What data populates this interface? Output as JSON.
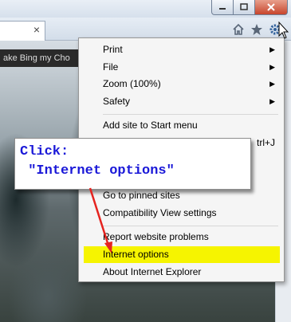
{
  "page": {
    "strip_text": "ake Bing my Cho"
  },
  "tab": {
    "close": "×"
  },
  "menu": {
    "items": [
      {
        "label": "Print",
        "submenu": true,
        "highlight": false
      },
      {
        "label": "File",
        "submenu": true,
        "highlight": false
      },
      {
        "label": "Zoom (100%)",
        "submenu": true,
        "highlight": false
      },
      {
        "label": "Safety",
        "submenu": true,
        "highlight": false
      },
      {
        "label": "Add site to Start menu",
        "submenu": false,
        "highlight": false
      },
      {
        "label": "Go to pinned sites",
        "submenu": false,
        "highlight": false
      },
      {
        "label": "Compatibility View settings",
        "submenu": false,
        "highlight": false
      },
      {
        "label": "Report website problems",
        "submenu": false,
        "highlight": false
      },
      {
        "label": "Internet options",
        "submenu": false,
        "highlight": true
      },
      {
        "label": "About Internet Explorer",
        "submenu": false,
        "highlight": false
      }
    ],
    "partial_shortcut": "trl+J"
  },
  "callout": {
    "line1": "Click:",
    "line2": " \"Internet options\""
  },
  "colors": {
    "highlight": "#f6f400",
    "callout_text": "#1a18d8",
    "arrow": "#e5231f"
  },
  "icons": [
    "minimize-icon",
    "maximize-icon",
    "close-icon",
    "home-icon",
    "favorites-star-icon",
    "tools-gear-icon",
    "mouse-cursor-icon"
  ]
}
